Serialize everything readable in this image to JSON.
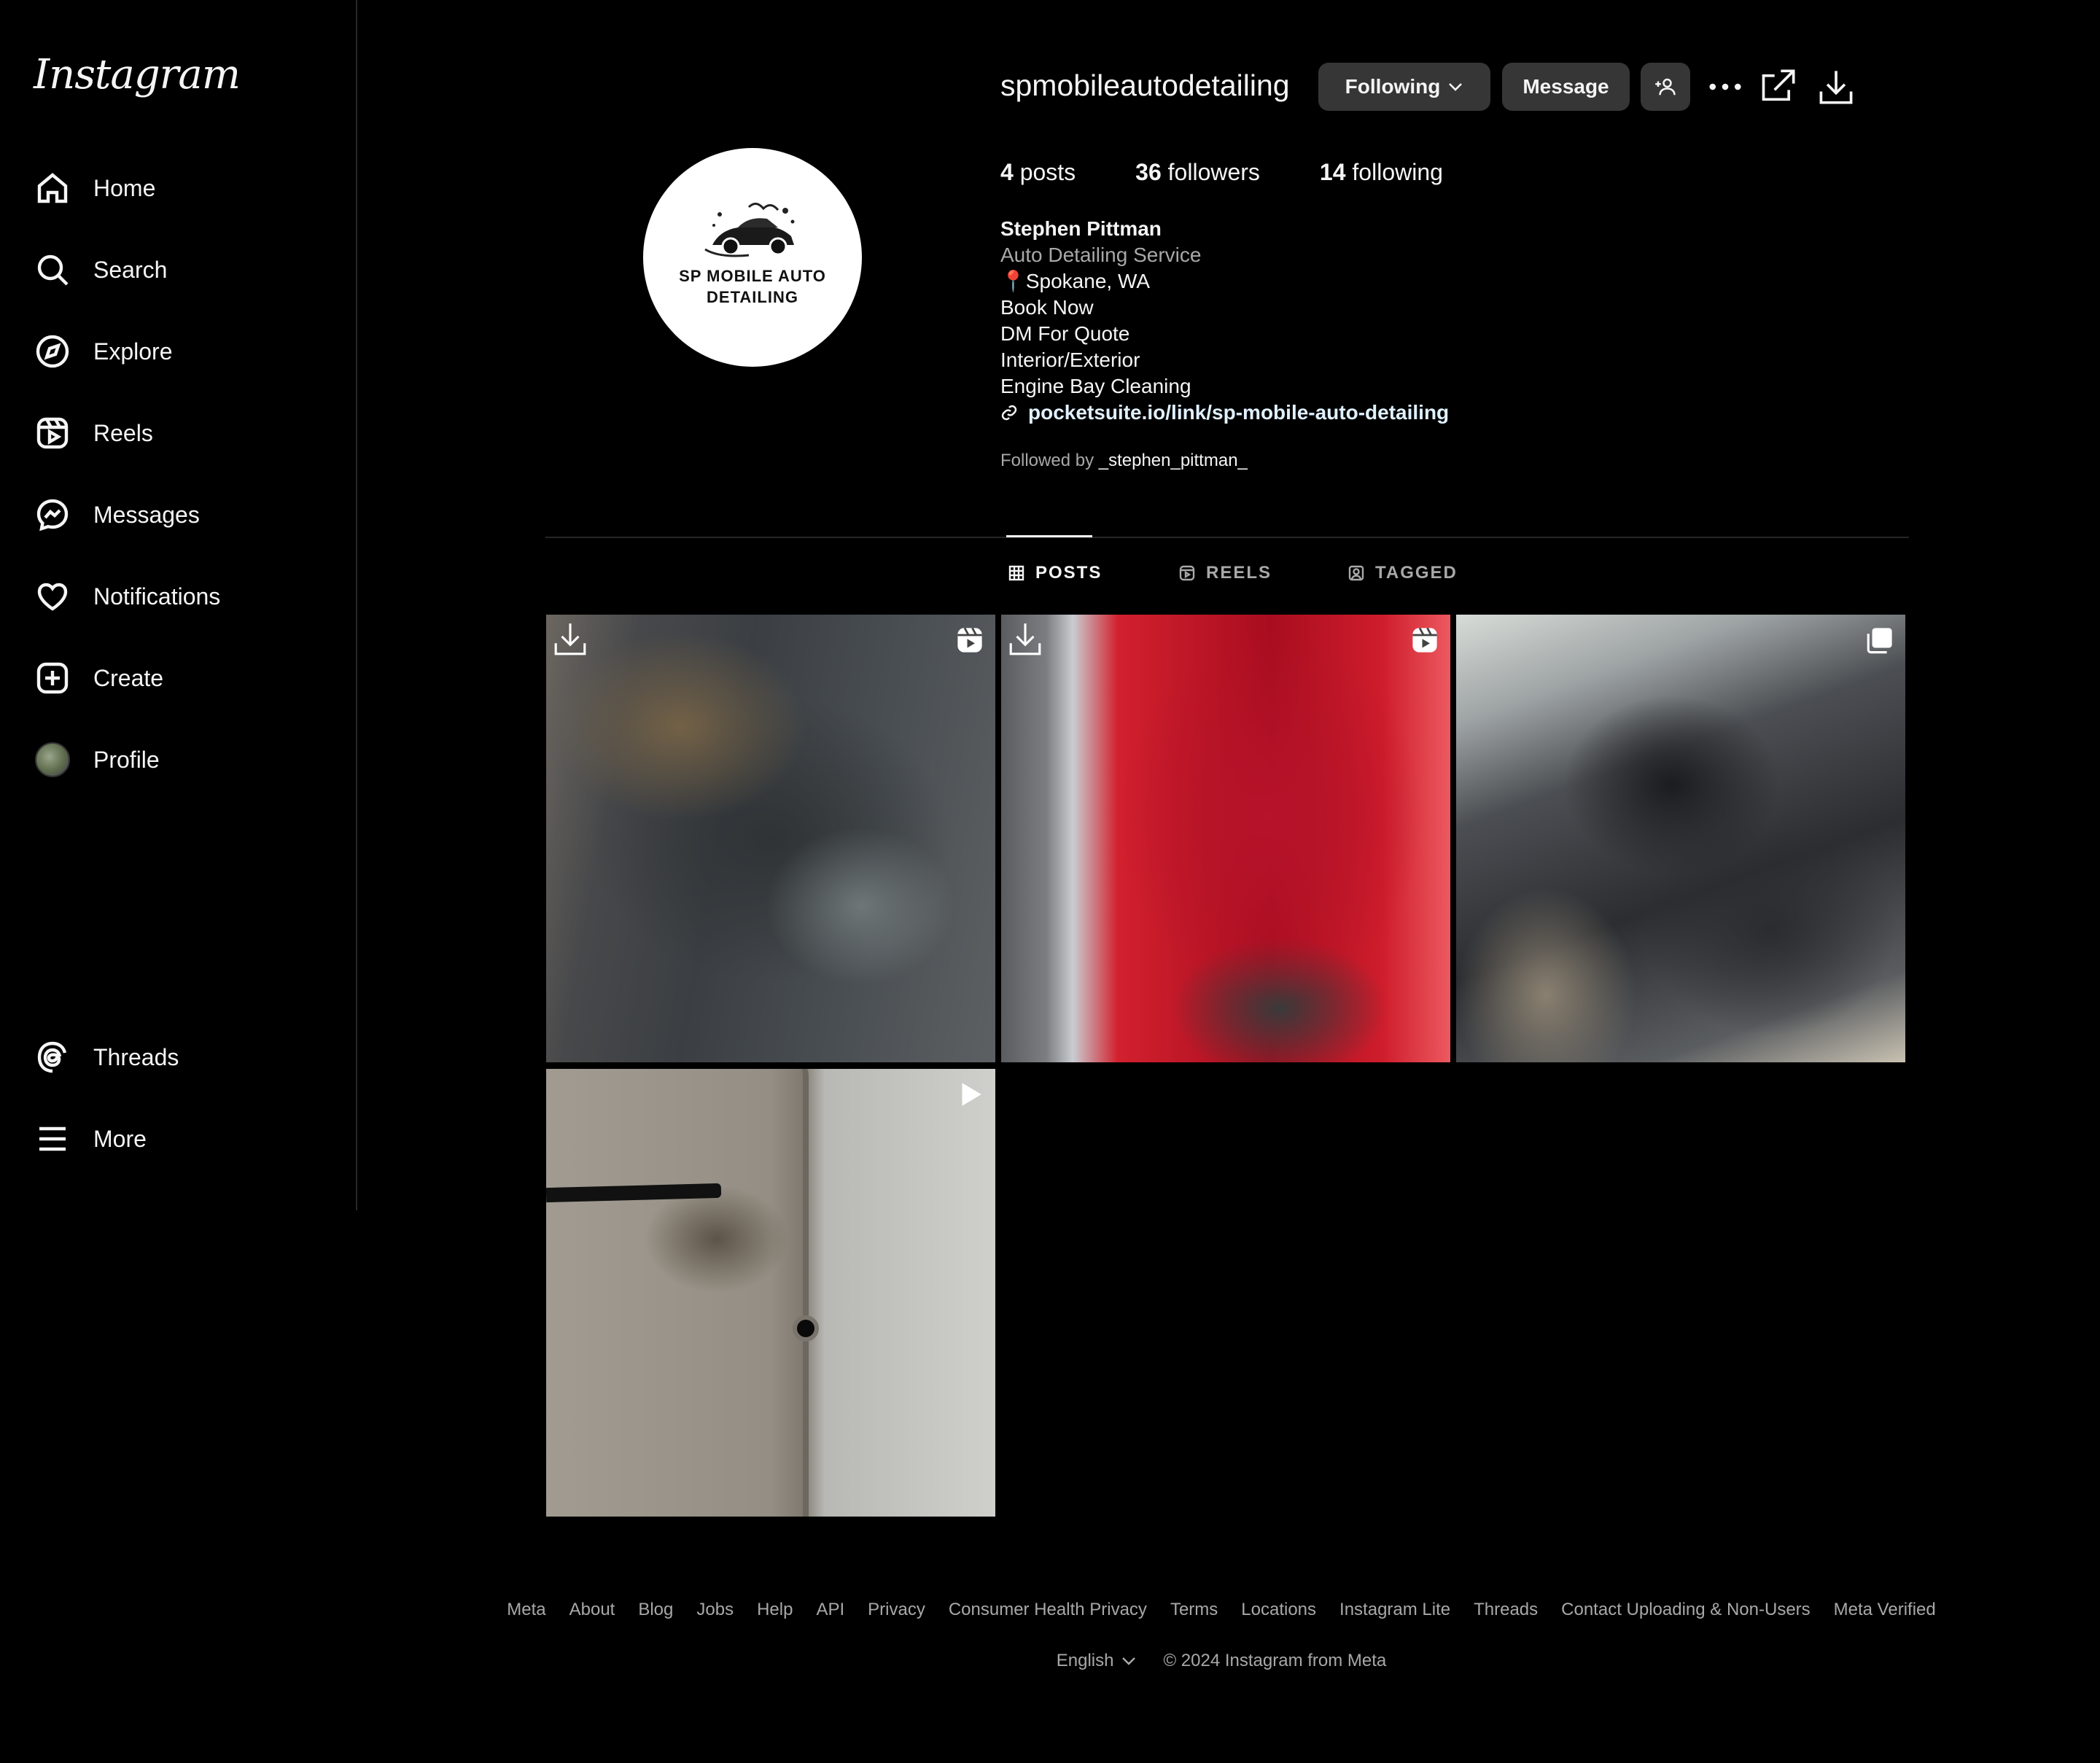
{
  "app": {
    "logo_text": "Instagram"
  },
  "sidebar": {
    "items": [
      {
        "label": "Home",
        "icon": "home-icon"
      },
      {
        "label": "Search",
        "icon": "search-icon"
      },
      {
        "label": "Explore",
        "icon": "compass-icon"
      },
      {
        "label": "Reels",
        "icon": "reels-icon"
      },
      {
        "label": "Messages",
        "icon": "messenger-icon"
      },
      {
        "label": "Notifications",
        "icon": "heart-icon"
      },
      {
        "label": "Create",
        "icon": "plus-square-icon"
      },
      {
        "label": "Profile",
        "icon": "avatar"
      }
    ],
    "bottom_items": [
      {
        "label": "Threads",
        "icon": "threads-icon"
      },
      {
        "label": "More",
        "icon": "hamburger-icon"
      }
    ]
  },
  "profile": {
    "username": "spmobileautodetailing",
    "avatar_text": [
      "SP MOBILE AUTO",
      "DETAILING"
    ],
    "buttons": {
      "following": "Following",
      "message": "Message",
      "add_user_icon": "add-user-icon"
    },
    "header_icons": [
      "more-icon",
      "open-external-icon",
      "download-icon"
    ],
    "stats": {
      "posts_count": "4",
      "posts_label": "posts",
      "followers_count": "36",
      "followers_label": "followers",
      "following_count": "14",
      "following_label": "following"
    },
    "bio": {
      "full_name": "Stephen Pittman",
      "category": "Auto Detailing Service",
      "lines": [
        "📍Spokane, WA",
        "Book Now",
        "DM For Quote",
        "Interior/Exterior",
        "Engine Bay Cleaning"
      ],
      "link": "pocketsuite.io/link/sp-mobile-auto-detailing"
    },
    "followed_by_prefix": "Followed by",
    "followed_by_user": "_stephen_pittman_"
  },
  "tabs": [
    {
      "label": "POSTS",
      "icon": "grid-icon",
      "active": true
    },
    {
      "label": "REELS",
      "icon": "reels-icon",
      "active": false
    },
    {
      "label": "TAGGED",
      "icon": "tagged-icon",
      "active": false
    }
  ],
  "posts": [
    {
      "type": "reel",
      "description_icon": "reel-badge-icon",
      "download_icon": "download-icon"
    },
    {
      "type": "reel",
      "description_icon": "reel-badge-icon",
      "download_icon": "download-icon"
    },
    {
      "type": "carousel",
      "description_icon": "carousel-badge-icon"
    },
    {
      "type": "video",
      "description_icon": "play-badge-icon"
    }
  ],
  "footer": {
    "links": [
      "Meta",
      "About",
      "Blog",
      "Jobs",
      "Help",
      "API",
      "Privacy",
      "Consumer Health Privacy",
      "Terms",
      "Locations",
      "Instagram Lite",
      "Threads",
      "Contact Uploading & Non-Users",
      "Meta Verified"
    ],
    "language": "English",
    "copyright": "© 2024 Instagram from Meta"
  }
}
